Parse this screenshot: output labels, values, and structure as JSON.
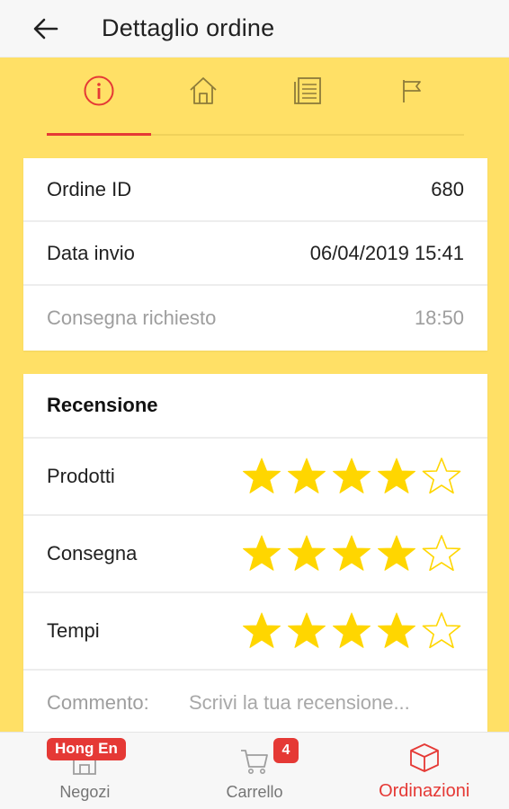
{
  "header": {
    "title": "Dettaglio ordine",
    "back_icon": "arrow-left-icon"
  },
  "tabs": [
    {
      "icon": "info-icon",
      "active": true
    },
    {
      "icon": "home-icon",
      "active": false
    },
    {
      "icon": "receipt-list-icon",
      "active": false
    },
    {
      "icon": "flag-icon",
      "active": false
    }
  ],
  "order_info": {
    "order_id_label": "Ordine ID",
    "order_id_value": "680",
    "sent_date_label": "Data invio",
    "sent_date_value": "06/04/2019 15:41",
    "delivery_label": "Consegna richiesto",
    "delivery_value": "18:50"
  },
  "review": {
    "title": "Recensione",
    "ratings": [
      {
        "label": "Prodotti",
        "stars": 4,
        "max": 5
      },
      {
        "label": "Consegna",
        "stars": 4,
        "max": 5
      },
      {
        "label": "Tempi",
        "stars": 4,
        "max": 5
      }
    ],
    "comment_label": "Commento:",
    "comment_placeholder": "Scrivi la tua recensione..."
  },
  "bottom_nav": {
    "shops": {
      "label": "Negozi",
      "badge": "Hong En",
      "icon": "shop-icon"
    },
    "cart": {
      "label": "Carrello",
      "badge": "4",
      "icon": "cart-icon"
    },
    "orders": {
      "label": "Ordinazioni",
      "icon": "box-icon",
      "active": true
    }
  },
  "colors": {
    "background": "#FFE066",
    "accent": "#E53935",
    "star": "#FFD600",
    "muted_text": "#9E9E9E"
  }
}
